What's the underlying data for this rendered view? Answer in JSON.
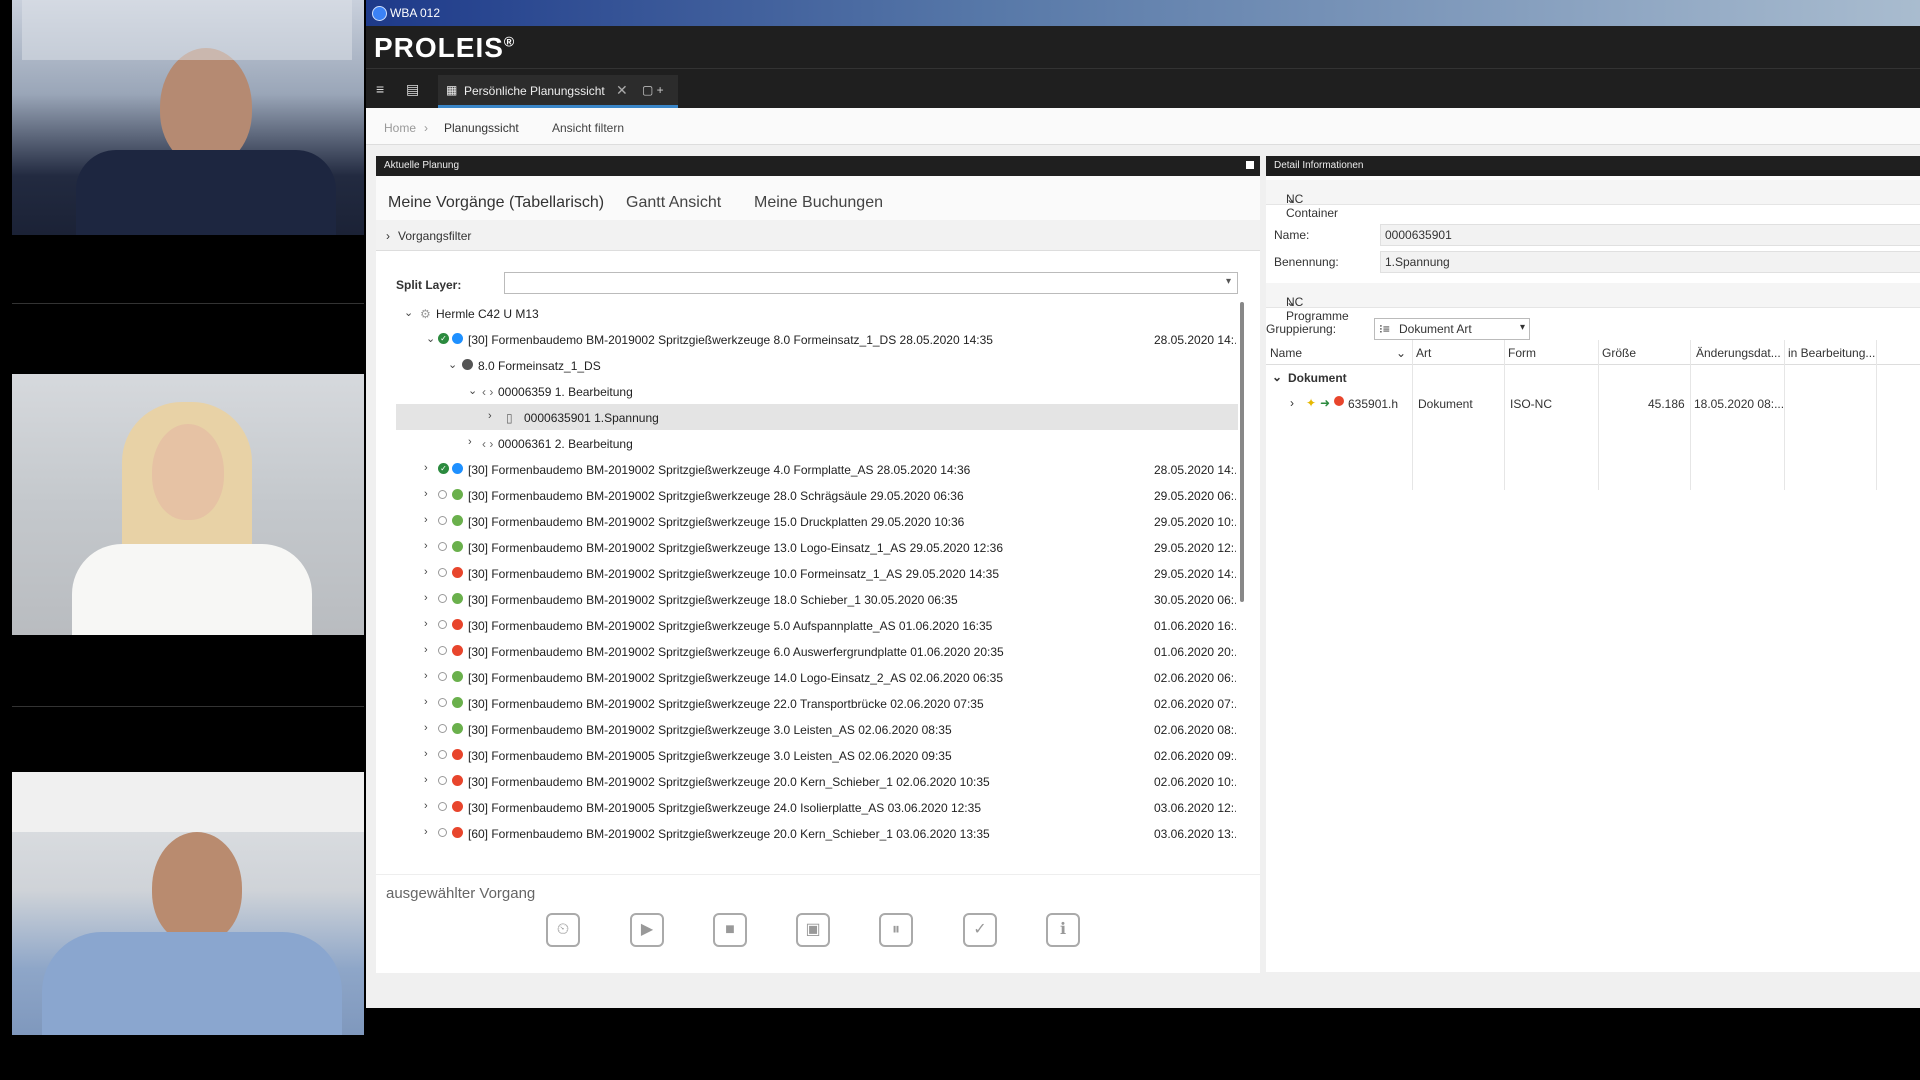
{
  "window_title": "WBA 012",
  "logo": "PROLEIS",
  "logo_mark": "®",
  "tabbar": {
    "active_tab": "Persönliche Planungssicht",
    "new_tab": "+"
  },
  "breadcrumb": {
    "home": "Home",
    "current": "Planungssicht",
    "filter": "Ansicht filtern"
  },
  "left_panel": {
    "header": "Aktuelle Planung",
    "tabs": [
      "Meine Vorgänge (Tabellarisch)",
      "Gantt Ansicht",
      "Meine Buchungen"
    ],
    "filter_label": "Vorgangsfilter",
    "split_label": "Split Layer:",
    "tree_root": "Hermle C42 U M13",
    "expanded_item": {
      "text": "[30] Formenbaudemo BM-2019002 Spritzgießwerkzeuge 8.0 Formeinsatz_1_DS 28.05.2020 14:35",
      "date": "28.05.2020 14:..."
    },
    "sub_item": "8.0 Formeinsatz_1_DS",
    "op1": "00006359 1. Bearbeitung",
    "op1_child": "0000635901 1.Spannung",
    "op2": "00006361 2. Bearbeitung",
    "items": [
      {
        "text": "[30] Formenbaudemo BM-2019002 Spritzgießwerkzeuge 4.0 Formplatte_AS 28.05.2020 14:36",
        "date": "28.05.2020 14:...",
        "status": "blue",
        "done": true
      },
      {
        "text": "[30] Formenbaudemo BM-2019002 Spritzgießwerkzeuge 28.0 Schrägsäule 29.05.2020 06:36",
        "date": "29.05.2020 06:...",
        "status": "green",
        "done": false
      },
      {
        "text": "[30] Formenbaudemo BM-2019002 Spritzgießwerkzeuge 15.0 Druckplatten 29.05.2020 10:36",
        "date": "29.05.2020 10:...",
        "status": "green",
        "done": false
      },
      {
        "text": "[30] Formenbaudemo BM-2019002 Spritzgießwerkzeuge 13.0 Logo-Einsatz_1_AS 29.05.2020 12:36",
        "date": "29.05.2020 12:...",
        "status": "green",
        "done": false
      },
      {
        "text": "[30] Formenbaudemo BM-2019002 Spritzgießwerkzeuge 10.0 Formeinsatz_1_AS 29.05.2020 14:35",
        "date": "29.05.2020 14:...",
        "status": "red",
        "done": false
      },
      {
        "text": "[30] Formenbaudemo BM-2019002 Spritzgießwerkzeuge 18.0 Schieber_1 30.05.2020 06:35",
        "date": "30.05.2020 06:...",
        "status": "green",
        "done": false
      },
      {
        "text": "[30] Formenbaudemo BM-2019002 Spritzgießwerkzeuge 5.0 Aufspannplatte_AS 01.06.2020 16:35",
        "date": "01.06.2020 16:...",
        "status": "red",
        "done": false
      },
      {
        "text": "[30] Formenbaudemo BM-2019002 Spritzgießwerkzeuge 6.0 Auswerfergrundplatte 01.06.2020 20:35",
        "date": "01.06.2020 20:...",
        "status": "red",
        "done": false
      },
      {
        "text": "[30] Formenbaudemo BM-2019002 Spritzgießwerkzeuge 14.0 Logo-Einsatz_2_AS 02.06.2020 06:35",
        "date": "02.06.2020 06:...",
        "status": "green",
        "done": false
      },
      {
        "text": "[30] Formenbaudemo BM-2019002 Spritzgießwerkzeuge 22.0 Transportbrücke 02.06.2020 07:35",
        "date": "02.06.2020 07:...",
        "status": "green",
        "done": false
      },
      {
        "text": "[30] Formenbaudemo BM-2019002 Spritzgießwerkzeuge 3.0 Leisten_AS 02.06.2020 08:35",
        "date": "02.06.2020 08:...",
        "status": "green",
        "done": false
      },
      {
        "text": "[30] Formenbaudemo BM-2019005 Spritzgießwerkzeuge 3.0 Leisten_AS 02.06.2020 09:35",
        "date": "02.06.2020 09:...",
        "status": "red",
        "done": false
      },
      {
        "text": "[30] Formenbaudemo BM-2019002 Spritzgießwerkzeuge 20.0 Kern_Schieber_1 02.06.2020 10:35",
        "date": "02.06.2020 10:...",
        "status": "red",
        "done": false
      },
      {
        "text": "[30] Formenbaudemo BM-2019005 Spritzgießwerkzeuge 24.0 Isolierplatte_AS 03.06.2020 12:35",
        "date": "03.06.2020 12:...",
        "status": "red",
        "done": false
      },
      {
        "text": "[60] Formenbaudemo BM-2019002 Spritzgießwerkzeuge 20.0 Kern_Schieber_1 03.06.2020 13:35",
        "date": "03.06.2020 13:...",
        "status": "red",
        "done": false
      }
    ],
    "selected_title": "ausgewählter Vorgang"
  },
  "right_panel": {
    "header": "Detail Informationen",
    "nc_container": "NC Container",
    "name_label": "Name:",
    "name_value": "0000635901",
    "benennung_label": "Benennung:",
    "benennung_value": "1.Spannung",
    "nc_programme": "NC Programme",
    "grouping_label": "Gruppierung:",
    "grouping_value": "Dokument Art",
    "columns": [
      "Name",
      "Art",
      "Form",
      "Größe",
      "Änderungsdat...",
      "in Bearbeitung..."
    ],
    "group": "Dokument",
    "row": {
      "name": "635901.h",
      "art": "Dokument",
      "form": "ISO-NC",
      "size": "45.186",
      "date": "18.05.2020 08:..."
    }
  },
  "colors": {
    "green": "#6ab04c",
    "red": "#e8452c",
    "blue": "#1e90ff",
    "accent": "#2f7bd1"
  }
}
